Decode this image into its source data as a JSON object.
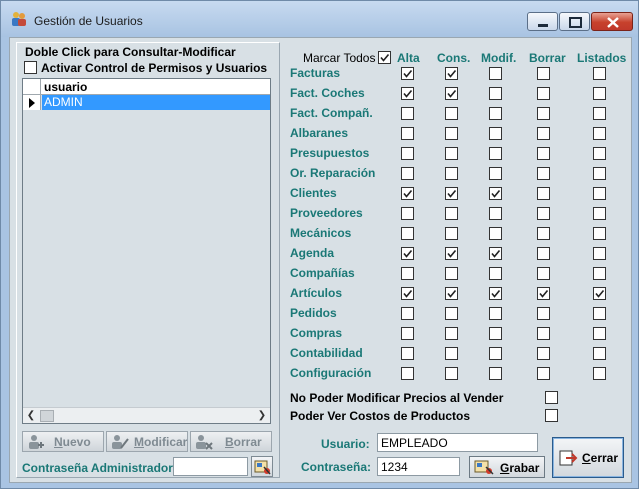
{
  "window": {
    "title": "Gestión de Usuarios"
  },
  "left": {
    "hint": "Doble Click para Consultar-Modificar",
    "activate_label": "Activar Control de Permisos y Usuarios",
    "activate_checked": false,
    "grid": {
      "column": "usuario",
      "rows": [
        {
          "usuario": "ADMIN",
          "selected": true
        }
      ]
    },
    "buttons": {
      "nuevo": {
        "underline": "N",
        "rest": "uevo"
      },
      "modificar": {
        "underline": "M",
        "rest": "odificar"
      },
      "borrar": {
        "underline": "B",
        "rest": "orrar"
      }
    },
    "admin_password_label": "Contraseña Administrador:",
    "admin_password_value": ""
  },
  "permissions": {
    "marcar_todos_label": "Marcar Todos",
    "marcar_todos_checked": true,
    "columns": [
      "Alta",
      "Cons.",
      "Modif.",
      "Borrar",
      "Listados"
    ],
    "rows": [
      {
        "name": "Facturas",
        "checks": [
          true,
          true,
          false,
          false,
          false
        ]
      },
      {
        "name": "Fact. Coches",
        "checks": [
          true,
          true,
          false,
          false,
          false
        ]
      },
      {
        "name": "Fact. Compañ.",
        "checks": [
          false,
          false,
          false,
          false,
          false
        ]
      },
      {
        "name": "Albaranes",
        "checks": [
          false,
          false,
          false,
          false,
          false
        ]
      },
      {
        "name": "Presupuestos",
        "checks": [
          false,
          false,
          false,
          false,
          false
        ]
      },
      {
        "name": "Or. Reparación",
        "checks": [
          false,
          false,
          false,
          false,
          false
        ]
      },
      {
        "name": "Clientes",
        "checks": [
          true,
          true,
          true,
          false,
          false
        ]
      },
      {
        "name": "Proveedores",
        "checks": [
          false,
          false,
          false,
          false,
          false
        ]
      },
      {
        "name": "Mecánicos",
        "checks": [
          false,
          false,
          false,
          false,
          false
        ]
      },
      {
        "name": "Agenda",
        "checks": [
          true,
          true,
          true,
          false,
          false
        ]
      },
      {
        "name": "Compañías",
        "checks": [
          false,
          false,
          false,
          false,
          false
        ]
      },
      {
        "name": "Artículos",
        "checks": [
          true,
          true,
          true,
          true,
          true
        ]
      },
      {
        "name": "Pedidos",
        "checks": [
          false,
          false,
          false,
          false,
          false
        ]
      },
      {
        "name": "Compras",
        "checks": [
          false,
          false,
          false,
          false,
          false
        ]
      },
      {
        "name": "Contabilidad",
        "checks": [
          false,
          false,
          false,
          false,
          false
        ]
      },
      {
        "name": "Configuración",
        "checks": [
          false,
          false,
          false,
          false,
          false
        ]
      }
    ],
    "extra": [
      {
        "name": "No Poder Modificar Precios al Vender",
        "checked": false
      },
      {
        "name": "Poder Ver Costos de Productos",
        "checked": false
      }
    ]
  },
  "user_form": {
    "usuario_label": "Usuario:",
    "usuario_value": "EMPLEADO",
    "contrasena_label": "Contraseña:",
    "contrasena_value": "1234",
    "grabar": {
      "underline": "G",
      "rest": "rabar"
    },
    "cerrar": {
      "underline": "C",
      "rest": "errar"
    }
  }
}
